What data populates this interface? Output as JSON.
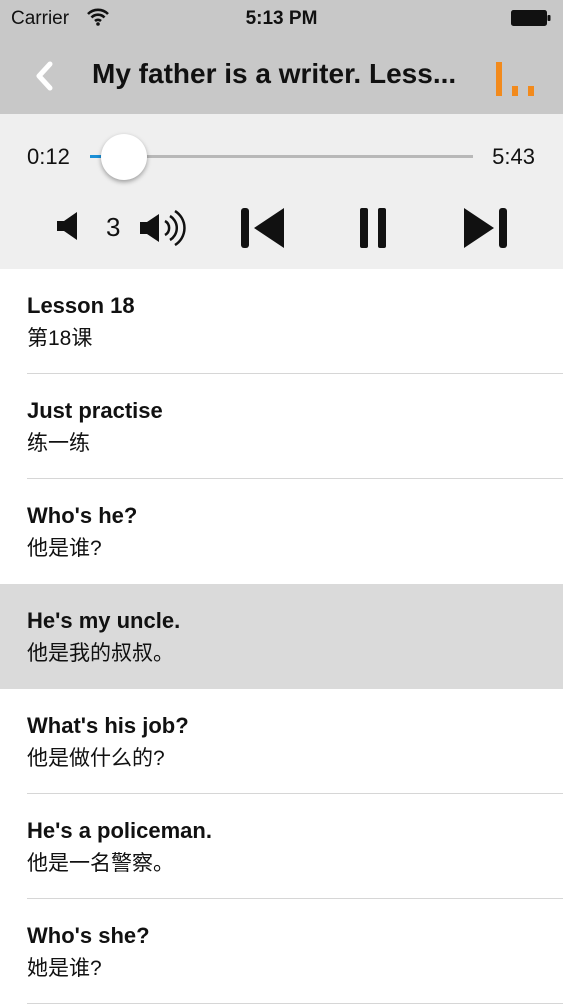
{
  "status_bar": {
    "carrier": "Carrier",
    "time": "5:13 PM"
  },
  "nav": {
    "title": "My father is a writer. Less...",
    "accent_color": "#f28a1c"
  },
  "player": {
    "current_time": "0:12",
    "duration": "5:43",
    "progress": 0.035,
    "volume_level": "3"
  },
  "sentences": [
    {
      "en": "Lesson 18",
      "zh": "第18课"
    },
    {
      "en": "Just practise",
      "zh": "练一练"
    },
    {
      "en": "Who's he?",
      "zh": "他是谁?"
    },
    {
      "en": "He's my uncle.",
      "zh": "他是我的叔叔。"
    },
    {
      "en": "What's his job?",
      "zh": "他是做什么的?"
    },
    {
      "en": "He's a policeman.",
      "zh": "他是一名警察。"
    },
    {
      "en": "Who's she?",
      "zh": "她是谁?"
    }
  ],
  "selected_index": 3
}
